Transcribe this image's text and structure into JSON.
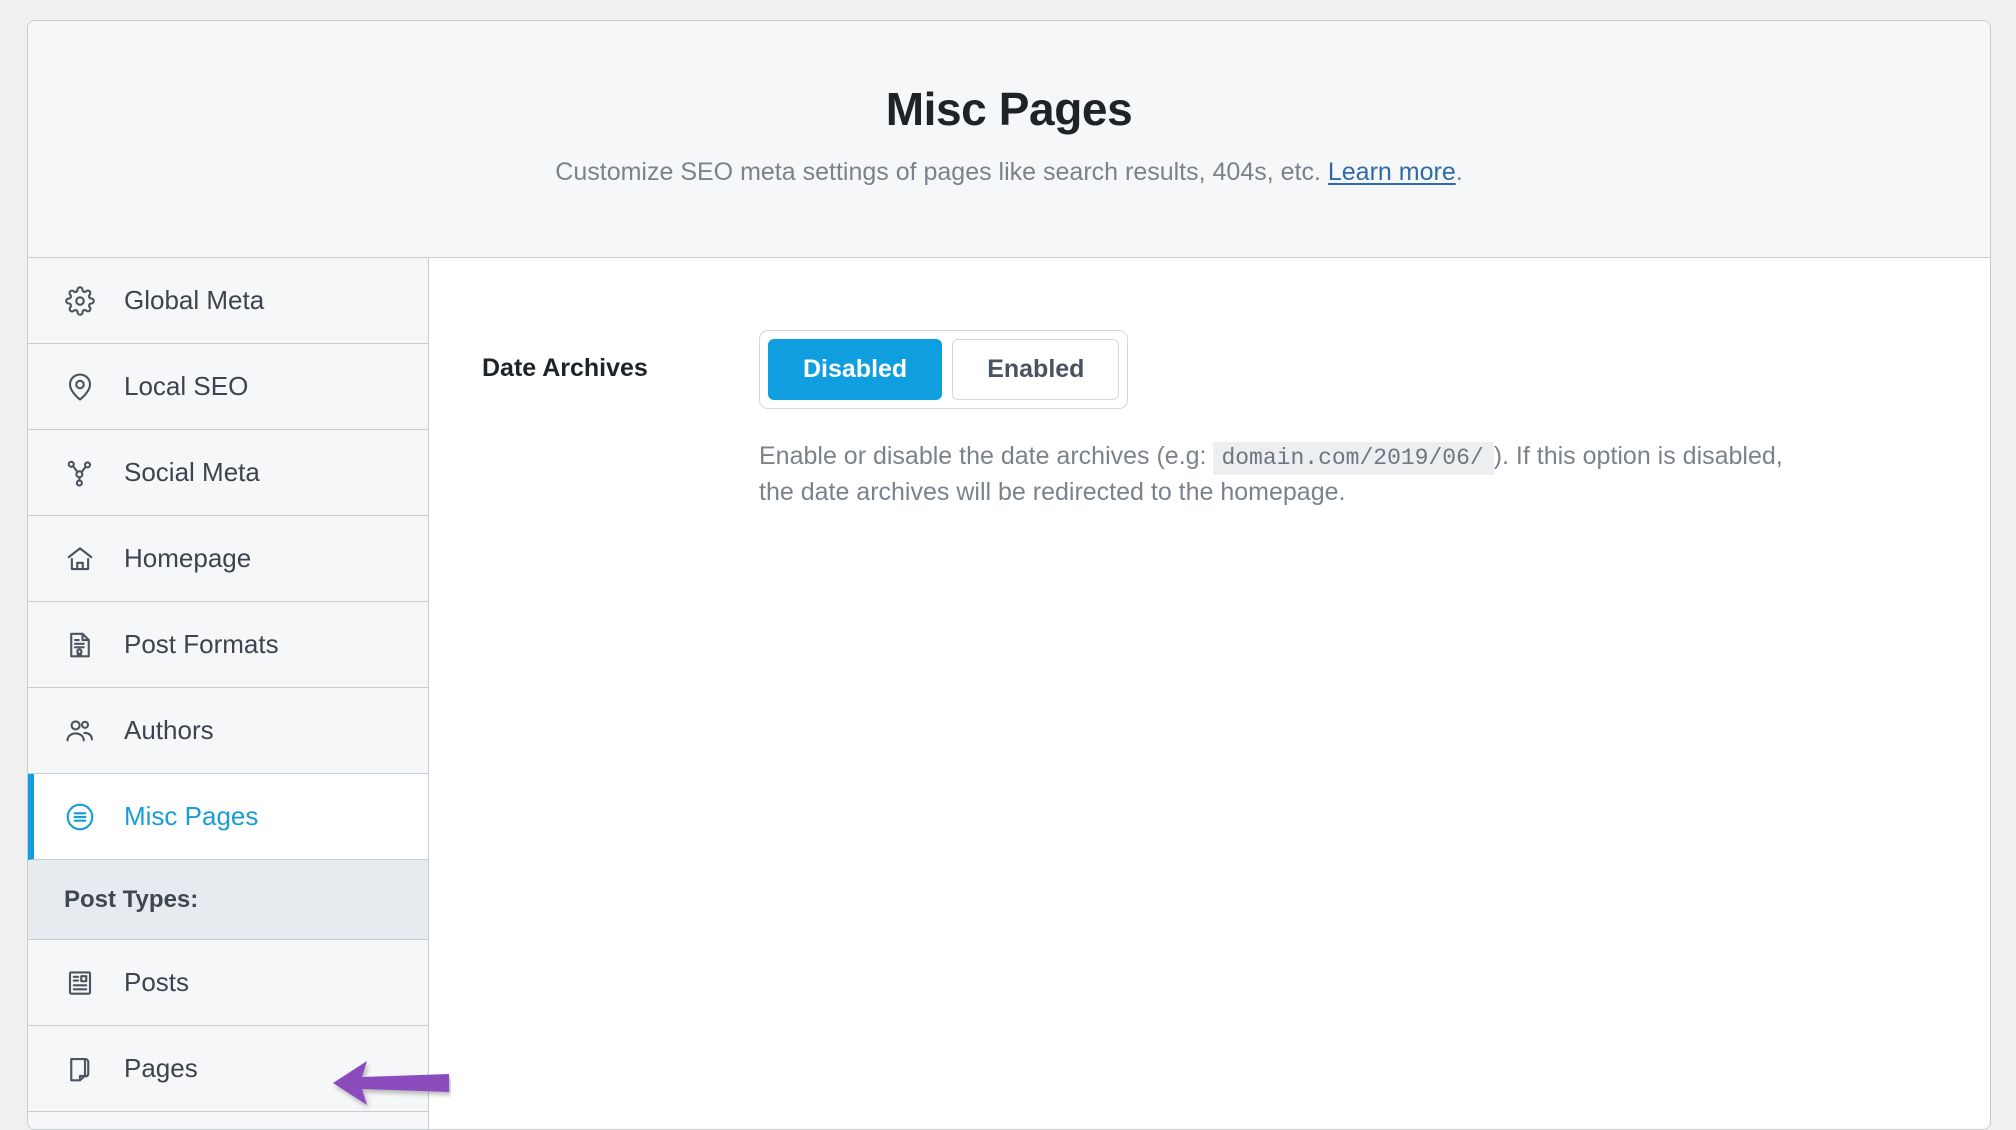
{
  "header": {
    "title": "Misc Pages",
    "subtitle_prefix": "Customize SEO meta settings of pages like search results, 404s, etc. ",
    "learn_more_label": "Learn more",
    "subtitle_suffix": "."
  },
  "sidebar": {
    "items": [
      {
        "label": "Global Meta",
        "icon": "gear-icon",
        "active": false
      },
      {
        "label": "Local SEO",
        "icon": "map-pin-icon",
        "active": false
      },
      {
        "label": "Social Meta",
        "icon": "share-nodes-icon",
        "active": false
      },
      {
        "label": "Homepage",
        "icon": "home-icon",
        "active": false
      },
      {
        "label": "Post Formats",
        "icon": "certificate-icon",
        "active": false
      },
      {
        "label": "Authors",
        "icon": "users-icon",
        "active": false
      },
      {
        "label": "Misc Pages",
        "icon": "list-circle-icon",
        "active": true
      }
    ],
    "section_label": "Post Types:",
    "post_types": [
      {
        "label": "Posts",
        "icon": "newspaper-icon"
      },
      {
        "label": "Pages",
        "icon": "page-curl-icon"
      }
    ],
    "annotation": {
      "name": "purple-arrow",
      "color": "#8a4bbd",
      "points_to": "Misc Pages"
    }
  },
  "main": {
    "field": {
      "label": "Date Archives",
      "options": [
        "Disabled",
        "Enabled"
      ],
      "selected": "Disabled",
      "description_part1": "Enable or disable the date archives (e.g:",
      "description_code": "domain.com/2019/06/",
      "description_part2": "). If this option is disabled, the date archives will be redirected to the homepage."
    }
  },
  "colors": {
    "accent_blue": "#0f9fe0",
    "link_blue": "#2f6ba6",
    "annotation_purple": "#8a4bbd",
    "panel_bg": "#f6f7f8",
    "border": "#c5ccd4"
  }
}
